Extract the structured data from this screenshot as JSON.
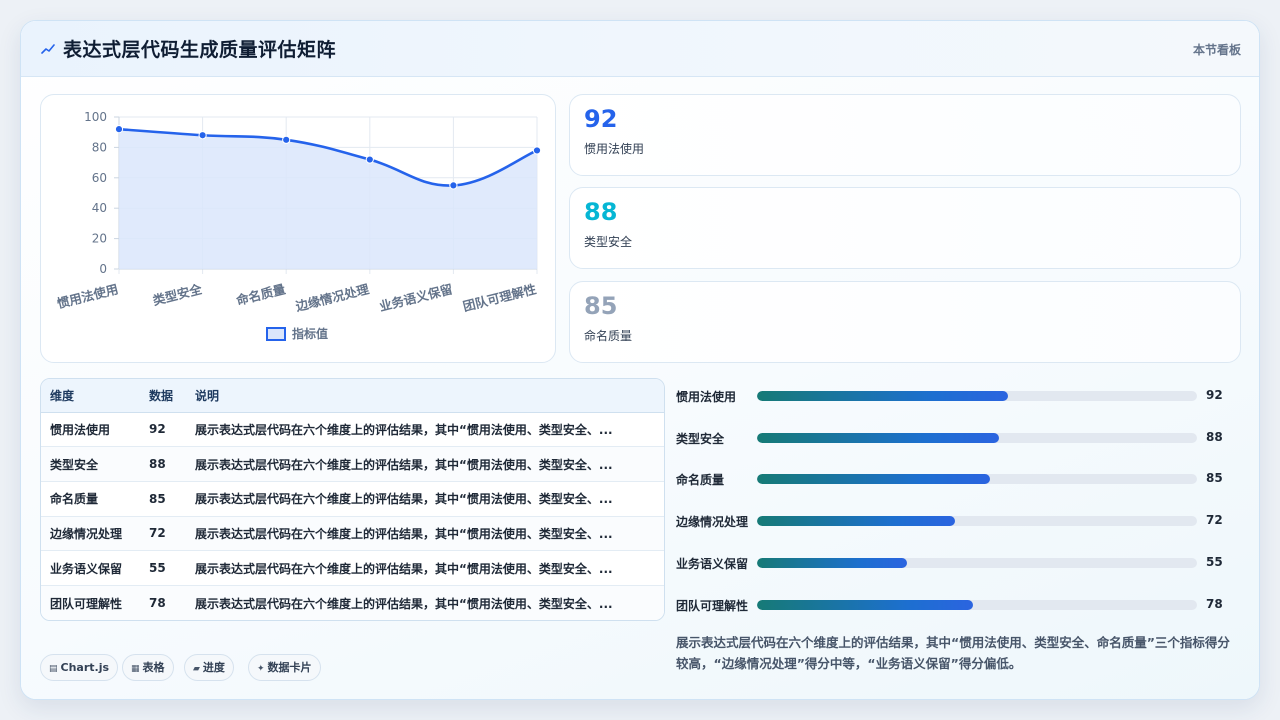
{
  "header": {
    "title": "表达式层代码生成质量评估矩阵",
    "link_label": "本节看板",
    "icon": "line-chart-icon"
  },
  "chart_data": {
    "type": "line",
    "categories": [
      "惯用法使用",
      "类型安全",
      "命名质量",
      "边缘情况处理",
      "业务语义保留",
      "团队可理解性"
    ],
    "series": [
      {
        "name": "指标值",
        "values": [
          92,
          88,
          85,
          72,
          55,
          78
        ],
        "color": "#2563eb",
        "fill": "#dbe6fb"
      }
    ],
    "ylim": [
      0,
      100
    ],
    "yticks": [
      0,
      20,
      40,
      60,
      80,
      100
    ],
    "grid": true,
    "legend": "bottom",
    "filled": true
  },
  "stats": [
    {
      "value": "92",
      "label": "惯用法使用",
      "color": "#2563eb"
    },
    {
      "value": "88",
      "label": "类型安全",
      "color": "#06b6d4"
    },
    {
      "value": "85",
      "label": "命名质量",
      "color": "#94a3b8"
    }
  ],
  "table": {
    "headers": [
      "维度",
      "数据",
      "说明"
    ],
    "rows": [
      {
        "dim": "惯用法使用",
        "value": "92",
        "desc": "展示表达式层代码在六个维度上的评估结果，其中“惯用法使用、类型安全、..."
      },
      {
        "dim": "类型安全",
        "value": "88",
        "desc": "展示表达式层代码在六个维度上的评估结果，其中“惯用法使用、类型安全、..."
      },
      {
        "dim": "命名质量",
        "value": "85",
        "desc": "展示表达式层代码在六个维度上的评估结果，其中“惯用法使用、类型安全、..."
      },
      {
        "dim": "边缘情况处理",
        "value": "72",
        "desc": "展示表达式层代码在六个维度上的评估结果，其中“惯用法使用、类型安全、..."
      },
      {
        "dim": "业务语义保留",
        "value": "55",
        "desc": "展示表达式层代码在六个维度上的评估结果，其中“惯用法使用、类型安全、..."
      },
      {
        "dim": "团队可理解性",
        "value": "78",
        "desc": "展示表达式层代码在六个维度上的评估结果，其中“惯用法使用、类型安全、..."
      }
    ]
  },
  "progress": [
    {
      "label": "惯用法使用",
      "value": "92",
      "fraction": 0.57
    },
    {
      "label": "类型安全",
      "value": "88",
      "fraction": 0.55
    },
    {
      "label": "命名质量",
      "value": "85",
      "fraction": 0.53
    },
    {
      "label": "边缘情况处理",
      "value": "72",
      "fraction": 0.45
    },
    {
      "label": "业务语义保留",
      "value": "55",
      "fraction": 0.34
    },
    {
      "label": "团队可理解性",
      "value": "78",
      "fraction": 0.49
    }
  ],
  "tags": [
    {
      "icon": "chart-icon",
      "glyph": "▤",
      "label": "Chart.js"
    },
    {
      "icon": "table-icon",
      "glyph": "▦",
      "label": "表格"
    },
    {
      "icon": "progress-icon",
      "glyph": "▰",
      "label": "进度"
    },
    {
      "icon": "sparkle-icon",
      "glyph": "✦",
      "label": "数据卡片"
    }
  ],
  "summary": "展示表达式层代码在六个维度上的评估结果，其中“惯用法使用、类型安全、命名质量”三个指标得分较高，“边缘情况处理”得分中等，“业务语义保留”得分偏低。"
}
